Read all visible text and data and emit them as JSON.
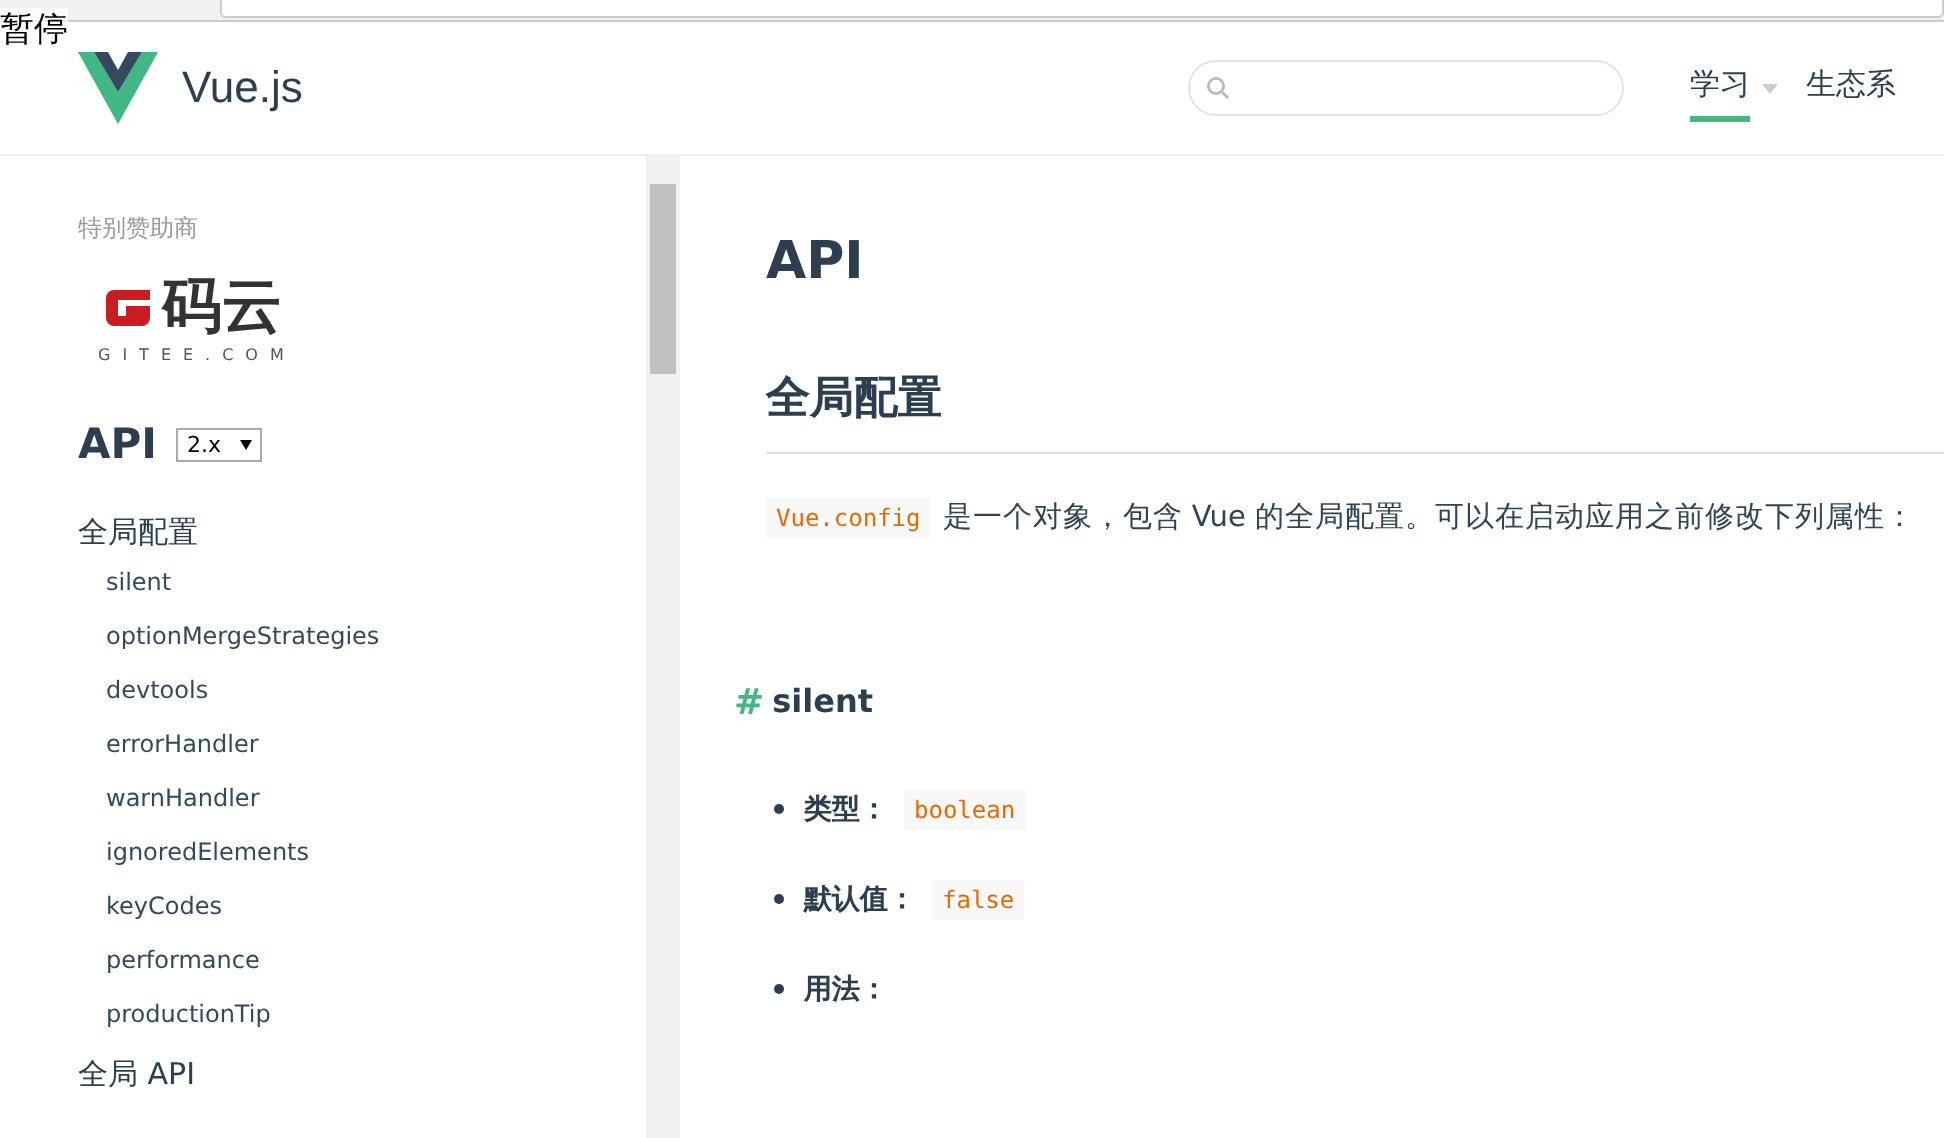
{
  "overlay": {
    "text": "暂停"
  },
  "header": {
    "brand": "Vue.js",
    "nav": [
      {
        "label": "学习",
        "dropdown": true,
        "selected": true
      },
      {
        "label": "生态系",
        "dropdown": false,
        "selected": false
      }
    ]
  },
  "sidebar": {
    "sponsor_label": "特别赞助商",
    "sponsor": {
      "name": "码云",
      "sub": "GITEE.COM"
    },
    "title": "API",
    "version": "2.x",
    "sections": [
      {
        "label": "全局配置",
        "children": [
          {
            "label": "silent"
          },
          {
            "label": "optionMergeStrategies"
          },
          {
            "label": "devtools"
          },
          {
            "label": "errorHandler"
          },
          {
            "label": "warnHandler"
          },
          {
            "label": "ignoredElements"
          },
          {
            "label": "keyCodes"
          },
          {
            "label": "performance"
          },
          {
            "label": "productionTip"
          }
        ]
      },
      {
        "label": "全局 API"
      }
    ]
  },
  "content": {
    "title": "API",
    "section": "全局配置",
    "intro_code": "Vue.config",
    "intro": "是一个对象，包含 Vue 的全局配置。可以在启动应用之前修改下列属性：",
    "subsection": {
      "anchor": "#",
      "title": "silent"
    },
    "props": [
      {
        "label": "类型：",
        "code": "boolean"
      },
      {
        "label": "默认值：",
        "code": "false"
      },
      {
        "label": "用法："
      }
    ]
  }
}
